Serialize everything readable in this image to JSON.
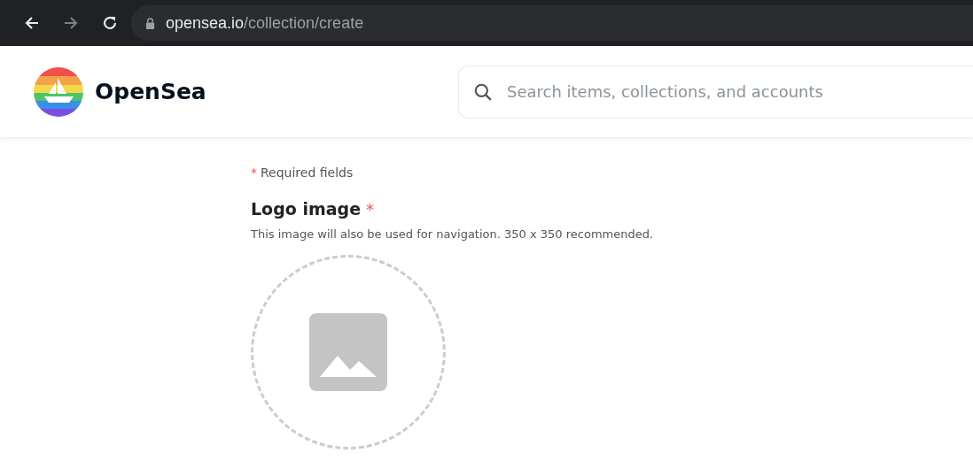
{
  "browser": {
    "url_host": "opensea.io",
    "url_path": "/collection/create"
  },
  "header": {
    "brand": "OpenSea",
    "search": {
      "placeholder": "Search items, collections, and accounts"
    }
  },
  "form": {
    "required_mark": "*",
    "required_note": "Required fields",
    "fields": [
      {
        "label": "Logo image",
        "required": true,
        "required_mark": "*",
        "description": "This image will also be used for navigation. 350 x 350 recommended.",
        "kind": "image"
      }
    ]
  }
}
